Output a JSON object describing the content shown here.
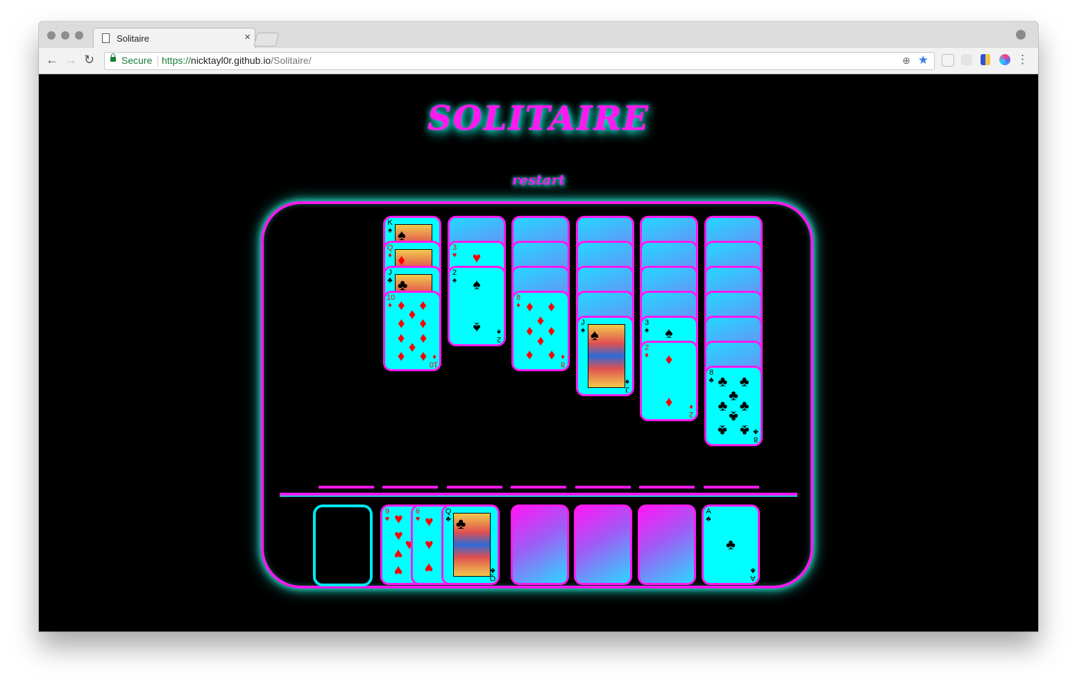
{
  "browser": {
    "tab_title": "Solitaire",
    "secure_label": "Secure",
    "url_scheme": "https://",
    "url_host": "nicktayl0r.github.io",
    "url_path": "/Solitaire/",
    "icons": {
      "back": "←",
      "forward": "→",
      "reload": "↻",
      "close_tab": "×",
      "zoom": "⊕",
      "bookmark_star": "★",
      "menu": "⋮"
    }
  },
  "game": {
    "title": "SOLITAIRE",
    "restart_label": "restart",
    "colors": {
      "accent": "#ff19f0",
      "card_face": "#00ffff",
      "glow": "#25e9d4",
      "red_suit": "#ff0000",
      "black_suit": "#000000"
    },
    "tableau": [
      {
        "hidden": 0,
        "cards": [
          {
            "rank": "K",
            "suit": "♠"
          },
          {
            "rank": "Q",
            "suit": "♦"
          },
          {
            "rank": "J",
            "suit": "♣"
          },
          {
            "rank": "10",
            "suit": "♦"
          }
        ]
      },
      {
        "hidden": 1,
        "cards": [
          {
            "rank": "3",
            "suit": "♥"
          },
          {
            "rank": "2",
            "suit": "♠"
          }
        ]
      },
      {
        "hidden": 3,
        "cards": [
          {
            "rank": "8",
            "suit": "♦"
          }
        ]
      },
      {
        "hidden": 4,
        "cards": [
          {
            "rank": "J",
            "suit": "♠"
          }
        ]
      },
      {
        "hidden": 4,
        "cards": [
          {
            "rank": "3",
            "suit": "♠"
          },
          {
            "rank": "2",
            "suit": "♦"
          }
        ]
      },
      {
        "hidden": 6,
        "cards": [
          {
            "rank": "8",
            "suit": "♣"
          }
        ]
      }
    ],
    "waste": [
      {
        "rank": "9",
        "suit": "♥"
      },
      {
        "rank": "6",
        "suit": "♥"
      },
      {
        "rank": "Q",
        "suit": "♣"
      }
    ],
    "foundations": [
      null,
      null,
      null,
      {
        "rank": "A",
        "suit": "♣"
      }
    ]
  }
}
